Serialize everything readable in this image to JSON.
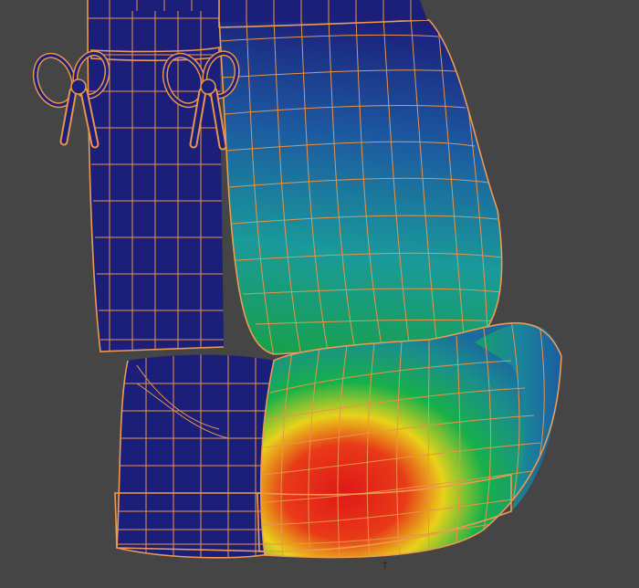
{
  "viewport": {
    "background": "#454545",
    "wire_color": "#e8944a",
    "base_color": "#1b1f7a",
    "weight_colors": [
      "#1b1f7a",
      "#1e78a8",
      "#18b04a",
      "#e8d21a",
      "#e01818"
    ],
    "pivot_marker": "†"
  }
}
